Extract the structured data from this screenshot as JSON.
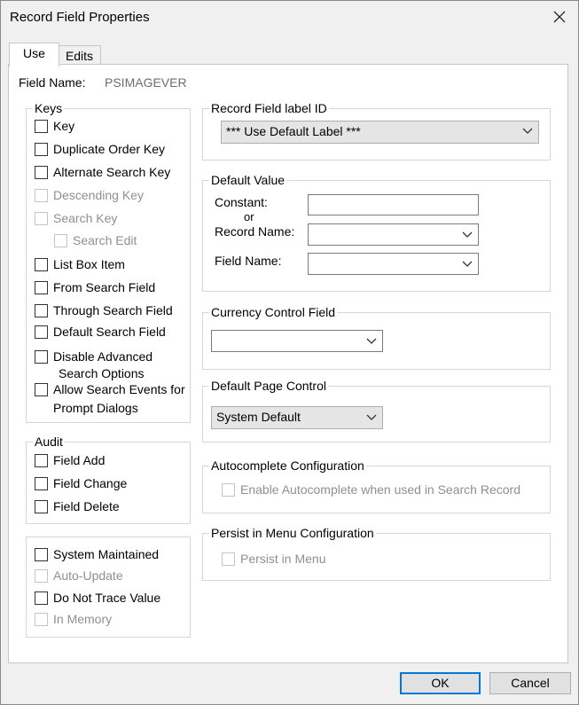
{
  "window": {
    "title": "Record Field Properties"
  },
  "tabs": [
    {
      "label": "Use"
    },
    {
      "label": "Edits"
    }
  ],
  "field_name": {
    "label": "Field Name:",
    "value": "PSIMAGEVER"
  },
  "keys": {
    "legend": "Keys",
    "items": [
      {
        "label": "Key",
        "enabled": true
      },
      {
        "label": "Duplicate Order Key",
        "enabled": true
      },
      {
        "label": "Alternate Search Key",
        "enabled": true
      },
      {
        "label": "Descending Key",
        "enabled": false
      },
      {
        "label": "Search Key",
        "enabled": false
      },
      {
        "label": "Search Edit",
        "enabled": false
      },
      {
        "label": "List Box Item",
        "enabled": true
      },
      {
        "label": "From Search Field",
        "enabled": true
      },
      {
        "label": "Through Search Field",
        "enabled": true
      },
      {
        "label": "Default Search Field",
        "enabled": true
      }
    ],
    "disable_advanced": {
      "line1": "Disable Advanced",
      "line2": "Search Options"
    },
    "allow_search_events": {
      "line1": "Allow Search Events for",
      "line2": "Prompt Dialogs"
    }
  },
  "audit": {
    "legend": "Audit",
    "items": [
      {
        "label": "Field Add",
        "enabled": true
      },
      {
        "label": "Field Change",
        "enabled": true
      },
      {
        "label": "Field Delete",
        "enabled": true
      }
    ]
  },
  "misc": {
    "items": [
      {
        "label": "System Maintained",
        "enabled": true
      },
      {
        "label": "Auto-Update",
        "enabled": false
      },
      {
        "label": "Do Not Trace Value",
        "enabled": true
      },
      {
        "label": "In Memory",
        "enabled": false
      }
    ]
  },
  "label_id": {
    "legend": "Record Field label ID",
    "selected": "*** Use Default Label ***"
  },
  "default_value": {
    "legend": "Default Value",
    "constant_label": "Constant:",
    "or_label": "or",
    "record_name_label": "Record Name:",
    "field_name_label": "Field Name:",
    "constant_value": "",
    "record_name_value": "",
    "field_name_value": ""
  },
  "currency_control": {
    "legend": "Currency Control Field",
    "selected": ""
  },
  "default_page_control": {
    "legend": "Default Page Control",
    "selected": "System Default"
  },
  "autocomplete": {
    "legend": "Autocomplete Configuration",
    "checkbox": "Enable Autocomplete when used in Search Record"
  },
  "persist_menu": {
    "legend": "Persist in Menu Configuration",
    "checkbox": "Persist in Menu"
  },
  "buttons": {
    "ok": "OK",
    "cancel": "Cancel"
  }
}
